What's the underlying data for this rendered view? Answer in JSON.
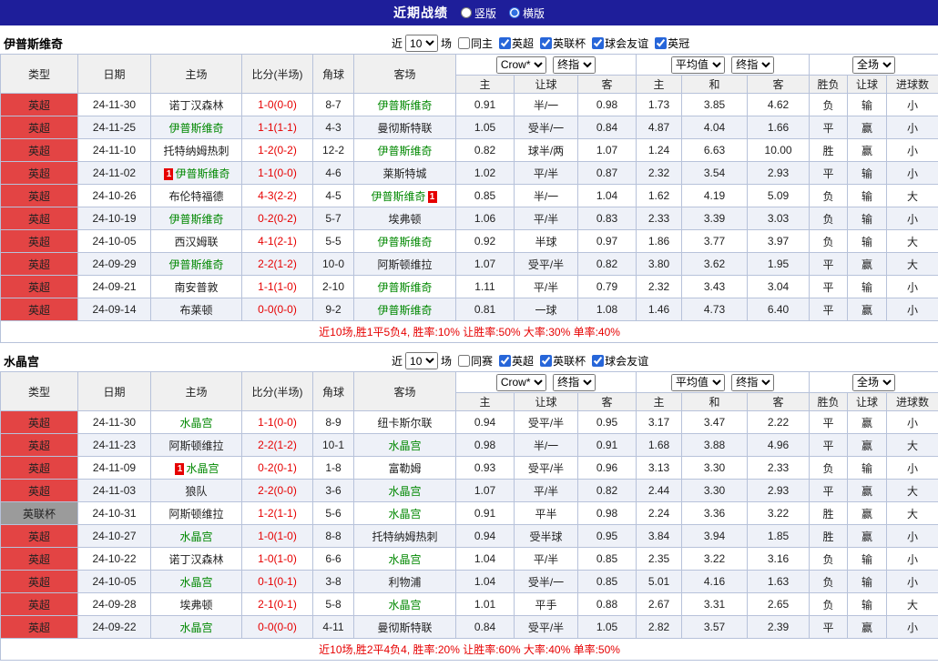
{
  "topbar": {
    "title": "近期战绩",
    "layout_options": [
      {
        "label": "竖版",
        "selected": false
      },
      {
        "label": "横版",
        "selected": true
      }
    ]
  },
  "columns": [
    "类型",
    "日期",
    "主场",
    "比分(半场)",
    "角球",
    "客场",
    "主",
    "让球",
    "客",
    "主",
    "和",
    "客",
    "胜负",
    "让球",
    "进球数"
  ],
  "colors": {
    "accent_bar": "#1e1e9a",
    "league_red": "#e34444",
    "league_gray": "#9b9b9b",
    "focus_team_green": "#008800",
    "score_red": "#e60000",
    "lose_blue": "#0000e0",
    "draw_green": "#008800",
    "win_red": "#e60000"
  },
  "sections": [
    {
      "team": "伊普斯维奇",
      "filter": {
        "near_label": "近",
        "count": "10",
        "matches_label": "场",
        "checkboxes": [
          {
            "label": "同主",
            "checked": false
          },
          {
            "label": "英超",
            "checked": true
          },
          {
            "label": "英联杯",
            "checked": true
          },
          {
            "label": "球会友谊",
            "checked": true
          },
          {
            "label": "英冠",
            "checked": true
          }
        ]
      },
      "dropdowns": {
        "bookmaker": "Crow*",
        "handicap_time": "终指",
        "europe_avg": "平均值",
        "europe_time": "终指",
        "scope": "全场"
      },
      "rows": [
        {
          "league": "英超",
          "league_color": "red",
          "date": "24-11-30",
          "home": "诺丁汉森林",
          "home_focus": false,
          "home_red": null,
          "score": "1-0",
          "half": "(0-0)",
          "corner": "8-7",
          "away": "伊普斯维奇",
          "away_focus": true,
          "away_red": null,
          "ah_home": "0.91",
          "ah_line": "半/一",
          "ah_away": "0.98",
          "eu_home": "1.73",
          "eu_draw": "3.85",
          "eu_away": "4.62",
          "result": "负",
          "result_color": "blue",
          "handicap": "输",
          "handicap_color": "blue",
          "goals": "小",
          "goals_color": "blue"
        },
        {
          "league": "英超",
          "league_color": "red",
          "date": "24-11-25",
          "home": "伊普斯维奇",
          "home_focus": true,
          "home_red": null,
          "score": "1-1",
          "half": "(1-1)",
          "corner": "4-3",
          "away": "曼彻斯特联",
          "away_focus": false,
          "away_red": null,
          "ah_home": "1.05",
          "ah_line": "受半/一",
          "ah_away": "0.84",
          "eu_home": "4.87",
          "eu_draw": "4.04",
          "eu_away": "1.66",
          "result": "平",
          "result_color": "green",
          "handicap": "赢",
          "handicap_color": "red",
          "goals": "小",
          "goals_color": "blue"
        },
        {
          "league": "英超",
          "league_color": "red",
          "date": "24-11-10",
          "home": "托特纳姆热刺",
          "home_focus": false,
          "home_red": null,
          "score": "1-2",
          "half": "(0-2)",
          "corner": "12-2",
          "away": "伊普斯维奇",
          "away_focus": true,
          "away_red": null,
          "ah_home": "0.82",
          "ah_line": "球半/两",
          "ah_away": "1.07",
          "eu_home": "1.24",
          "eu_draw": "6.63",
          "eu_away": "10.00",
          "result": "胜",
          "result_color": "red",
          "handicap": "赢",
          "handicap_color": "red",
          "goals": "小",
          "goals_color": "blue"
        },
        {
          "league": "英超",
          "league_color": "red",
          "date": "24-11-02",
          "home": "伊普斯维奇",
          "home_focus": true,
          "home_red": {
            "pos": "before",
            "count": "1"
          },
          "score": "1-1",
          "half": "(0-0)",
          "corner": "4-6",
          "away": "莱斯特城",
          "away_focus": false,
          "away_red": null,
          "ah_home": "1.02",
          "ah_line": "平/半",
          "ah_away": "0.87",
          "eu_home": "2.32",
          "eu_draw": "3.54",
          "eu_away": "2.93",
          "result": "平",
          "result_color": "green",
          "handicap": "输",
          "handicap_color": "blue",
          "goals": "小",
          "goals_color": "blue"
        },
        {
          "league": "英超",
          "league_color": "red",
          "date": "24-10-26",
          "home": "布伦特福德",
          "home_focus": false,
          "home_red": null,
          "score": "4-3",
          "half": "(2-2)",
          "corner": "4-5",
          "away": "伊普斯维奇",
          "away_focus": true,
          "away_red": {
            "pos": "after",
            "count": "1"
          },
          "ah_home": "0.85",
          "ah_line": "半/一",
          "ah_away": "1.04",
          "eu_home": "1.62",
          "eu_draw": "4.19",
          "eu_away": "5.09",
          "result": "负",
          "result_color": "blue",
          "handicap": "输",
          "handicap_color": "blue",
          "goals": "大",
          "goals_color": "red"
        },
        {
          "league": "英超",
          "league_color": "red",
          "date": "24-10-19",
          "home": "伊普斯维奇",
          "home_focus": true,
          "home_red": null,
          "score": "0-2",
          "half": "(0-2)",
          "corner": "5-7",
          "away": "埃弗顿",
          "away_focus": false,
          "away_red": null,
          "ah_home": "1.06",
          "ah_line": "平/半",
          "ah_away": "0.83",
          "eu_home": "2.33",
          "eu_draw": "3.39",
          "eu_away": "3.03",
          "result": "负",
          "result_color": "blue",
          "handicap": "输",
          "handicap_color": "blue",
          "goals": "小",
          "goals_color": "blue"
        },
        {
          "league": "英超",
          "league_color": "red",
          "date": "24-10-05",
          "home": "西汉姆联",
          "home_focus": false,
          "home_red": null,
          "score": "4-1",
          "half": "(2-1)",
          "corner": "5-5",
          "away": "伊普斯维奇",
          "away_focus": true,
          "away_red": null,
          "ah_home": "0.92",
          "ah_line": "半球",
          "ah_away": "0.97",
          "eu_home": "1.86",
          "eu_draw": "3.77",
          "eu_away": "3.97",
          "result": "负",
          "result_color": "blue",
          "handicap": "输",
          "handicap_color": "blue",
          "goals": "大",
          "goals_color": "red"
        },
        {
          "league": "英超",
          "league_color": "red",
          "date": "24-09-29",
          "home": "伊普斯维奇",
          "home_focus": true,
          "home_red": null,
          "score": "2-2",
          "half": "(1-2)",
          "corner": "10-0",
          "away": "阿斯顿维拉",
          "away_focus": false,
          "away_red": null,
          "ah_home": "1.07",
          "ah_line": "受平/半",
          "ah_away": "0.82",
          "eu_home": "3.80",
          "eu_draw": "3.62",
          "eu_away": "1.95",
          "result": "平",
          "result_color": "green",
          "handicap": "赢",
          "handicap_color": "red",
          "goals": "大",
          "goals_color": "red"
        },
        {
          "league": "英超",
          "league_color": "red",
          "date": "24-09-21",
          "home": "南安普敦",
          "home_focus": false,
          "home_red": null,
          "score": "1-1",
          "half": "(1-0)",
          "corner": "2-10",
          "away": "伊普斯维奇",
          "away_focus": true,
          "away_red": null,
          "ah_home": "1.11",
          "ah_line": "平/半",
          "ah_away": "0.79",
          "eu_home": "2.32",
          "eu_draw": "3.43",
          "eu_away": "3.04",
          "result": "平",
          "result_color": "green",
          "handicap": "输",
          "handicap_color": "blue",
          "goals": "小",
          "goals_color": "blue"
        },
        {
          "league": "英超",
          "league_color": "red",
          "date": "24-09-14",
          "home": "布莱顿",
          "home_focus": false,
          "home_red": null,
          "score": "0-0",
          "half": "(0-0)",
          "corner": "9-2",
          "away": "伊普斯维奇",
          "away_focus": true,
          "away_red": null,
          "ah_home": "0.81",
          "ah_line": "一球",
          "ah_away": "1.08",
          "eu_home": "1.46",
          "eu_draw": "4.73",
          "eu_away": "6.40",
          "result": "平",
          "result_color": "green",
          "handicap": "赢",
          "handicap_color": "red",
          "goals": "小",
          "goals_color": "blue"
        }
      ],
      "summary": "近10场,胜1平5负4, 胜率:10% 让胜率:50% 大率:30% 单率:40%"
    },
    {
      "team": "水晶宫",
      "filter": {
        "near_label": "近",
        "count": "10",
        "matches_label": "场",
        "checkboxes": [
          {
            "label": "同赛",
            "checked": false
          },
          {
            "label": "英超",
            "checked": true
          },
          {
            "label": "英联杯",
            "checked": true
          },
          {
            "label": "球会友谊",
            "checked": true
          }
        ]
      },
      "dropdowns": {
        "bookmaker": "Crow*",
        "handicap_time": "终指",
        "europe_avg": "平均值",
        "europe_time": "终指",
        "scope": "全场"
      },
      "rows": [
        {
          "league": "英超",
          "league_color": "red",
          "date": "24-11-30",
          "home": "水晶宫",
          "home_focus": true,
          "home_red": null,
          "score": "1-1",
          "half": "(0-0)",
          "corner": "8-9",
          "away": "纽卡斯尔联",
          "away_focus": false,
          "away_red": null,
          "ah_home": "0.94",
          "ah_line": "受平/半",
          "ah_away": "0.95",
          "eu_home": "3.17",
          "eu_draw": "3.47",
          "eu_away": "2.22",
          "result": "平",
          "result_color": "green",
          "handicap": "赢",
          "handicap_color": "red",
          "goals": "小",
          "goals_color": "blue"
        },
        {
          "league": "英超",
          "league_color": "red",
          "date": "24-11-23",
          "home": "阿斯顿维拉",
          "home_focus": false,
          "home_red": null,
          "score": "2-2",
          "half": "(1-2)",
          "corner": "10-1",
          "away": "水晶宫",
          "away_focus": true,
          "away_red": null,
          "ah_home": "0.98",
          "ah_line": "半/一",
          "ah_away": "0.91",
          "eu_home": "1.68",
          "eu_draw": "3.88",
          "eu_away": "4.96",
          "result": "平",
          "result_color": "green",
          "handicap": "赢",
          "handicap_color": "red",
          "goals": "大",
          "goals_color": "red"
        },
        {
          "league": "英超",
          "league_color": "red",
          "date": "24-11-09",
          "home": "水晶宫",
          "home_focus": true,
          "home_red": {
            "pos": "before",
            "count": "1"
          },
          "score": "0-2",
          "half": "(0-1)",
          "corner": "1-8",
          "away": "富勒姆",
          "away_focus": false,
          "away_red": null,
          "ah_home": "0.93",
          "ah_line": "受平/半",
          "ah_away": "0.96",
          "eu_home": "3.13",
          "eu_draw": "3.30",
          "eu_away": "2.33",
          "result": "负",
          "result_color": "blue",
          "handicap": "输",
          "handicap_color": "blue",
          "goals": "小",
          "goals_color": "blue"
        },
        {
          "league": "英超",
          "league_color": "red",
          "date": "24-11-03",
          "home": "狼队",
          "home_focus": false,
          "home_red": null,
          "score": "2-2",
          "half": "(0-0)",
          "corner": "3-6",
          "away": "水晶宫",
          "away_focus": true,
          "away_red": null,
          "ah_home": "1.07",
          "ah_line": "平/半",
          "ah_away": "0.82",
          "eu_home": "2.44",
          "eu_draw": "3.30",
          "eu_away": "2.93",
          "result": "平",
          "result_color": "green",
          "handicap": "赢",
          "handicap_color": "red",
          "goals": "大",
          "goals_color": "red"
        },
        {
          "league": "英联杯",
          "league_color": "gray",
          "date": "24-10-31",
          "home": "阿斯顿维拉",
          "home_focus": false,
          "home_red": null,
          "score": "1-2",
          "half": "(1-1)",
          "corner": "5-6",
          "away": "水晶宫",
          "away_focus": true,
          "away_red": null,
          "ah_home": "0.91",
          "ah_line": "平半",
          "ah_away": "0.98",
          "eu_home": "2.24",
          "eu_draw": "3.36",
          "eu_away": "3.22",
          "result": "胜",
          "result_color": "red",
          "handicap": "赢",
          "handicap_color": "red",
          "goals": "大",
          "goals_color": "red"
        },
        {
          "league": "英超",
          "league_color": "red",
          "date": "24-10-27",
          "home": "水晶宫",
          "home_focus": true,
          "home_red": null,
          "score": "1-0",
          "half": "(1-0)",
          "corner": "8-8",
          "away": "托特纳姆热刺",
          "away_focus": false,
          "away_red": null,
          "ah_home": "0.94",
          "ah_line": "受半球",
          "ah_away": "0.95",
          "eu_home": "3.84",
          "eu_draw": "3.94",
          "eu_away": "1.85",
          "result": "胜",
          "result_color": "red",
          "handicap": "赢",
          "handicap_color": "red",
          "goals": "小",
          "goals_color": "blue"
        },
        {
          "league": "英超",
          "league_color": "red",
          "date": "24-10-22",
          "home": "诺丁汉森林",
          "home_focus": false,
          "home_red": null,
          "score": "1-0",
          "half": "(1-0)",
          "corner": "6-6",
          "away": "水晶宫",
          "away_focus": true,
          "away_red": null,
          "ah_home": "1.04",
          "ah_line": "平/半",
          "ah_away": "0.85",
          "eu_home": "2.35",
          "eu_draw": "3.22",
          "eu_away": "3.16",
          "result": "负",
          "result_color": "blue",
          "handicap": "输",
          "handicap_color": "blue",
          "goals": "小",
          "goals_color": "blue"
        },
        {
          "league": "英超",
          "league_color": "red",
          "date": "24-10-05",
          "home": "水晶宫",
          "home_focus": true,
          "home_red": null,
          "score": "0-1",
          "half": "(0-1)",
          "corner": "3-8",
          "away": "利物浦",
          "away_focus": false,
          "away_red": null,
          "ah_home": "1.04",
          "ah_line": "受半/一",
          "ah_away": "0.85",
          "eu_home": "5.01",
          "eu_draw": "4.16",
          "eu_away": "1.63",
          "result": "负",
          "result_color": "blue",
          "handicap": "输",
          "handicap_color": "blue",
          "goals": "小",
          "goals_color": "blue"
        },
        {
          "league": "英超",
          "league_color": "red",
          "date": "24-09-28",
          "home": "埃弗顿",
          "home_focus": false,
          "home_red": null,
          "score": "2-1",
          "half": "(0-1)",
          "corner": "5-8",
          "away": "水晶宫",
          "away_focus": true,
          "away_red": null,
          "ah_home": "1.01",
          "ah_line": "平手",
          "ah_away": "0.88",
          "eu_home": "2.67",
          "eu_draw": "3.31",
          "eu_away": "2.65",
          "result": "负",
          "result_color": "blue",
          "handicap": "输",
          "handicap_color": "blue",
          "goals": "大",
          "goals_color": "red"
        },
        {
          "league": "英超",
          "league_color": "red",
          "date": "24-09-22",
          "home": "水晶宫",
          "home_focus": true,
          "home_red": null,
          "score": "0-0",
          "half": "(0-0)",
          "corner": "4-11",
          "away": "曼彻斯特联",
          "away_focus": false,
          "away_red": null,
          "ah_home": "0.84",
          "ah_line": "受平/半",
          "ah_away": "1.05",
          "eu_home": "2.82",
          "eu_draw": "3.57",
          "eu_away": "2.39",
          "result": "平",
          "result_color": "green",
          "handicap": "赢",
          "handicap_color": "red",
          "goals": "小",
          "goals_color": "blue"
        }
      ],
      "summary": "近10场,胜2平4负4, 胜率:20% 让胜率:60% 大率:40% 单率:50%"
    }
  ]
}
